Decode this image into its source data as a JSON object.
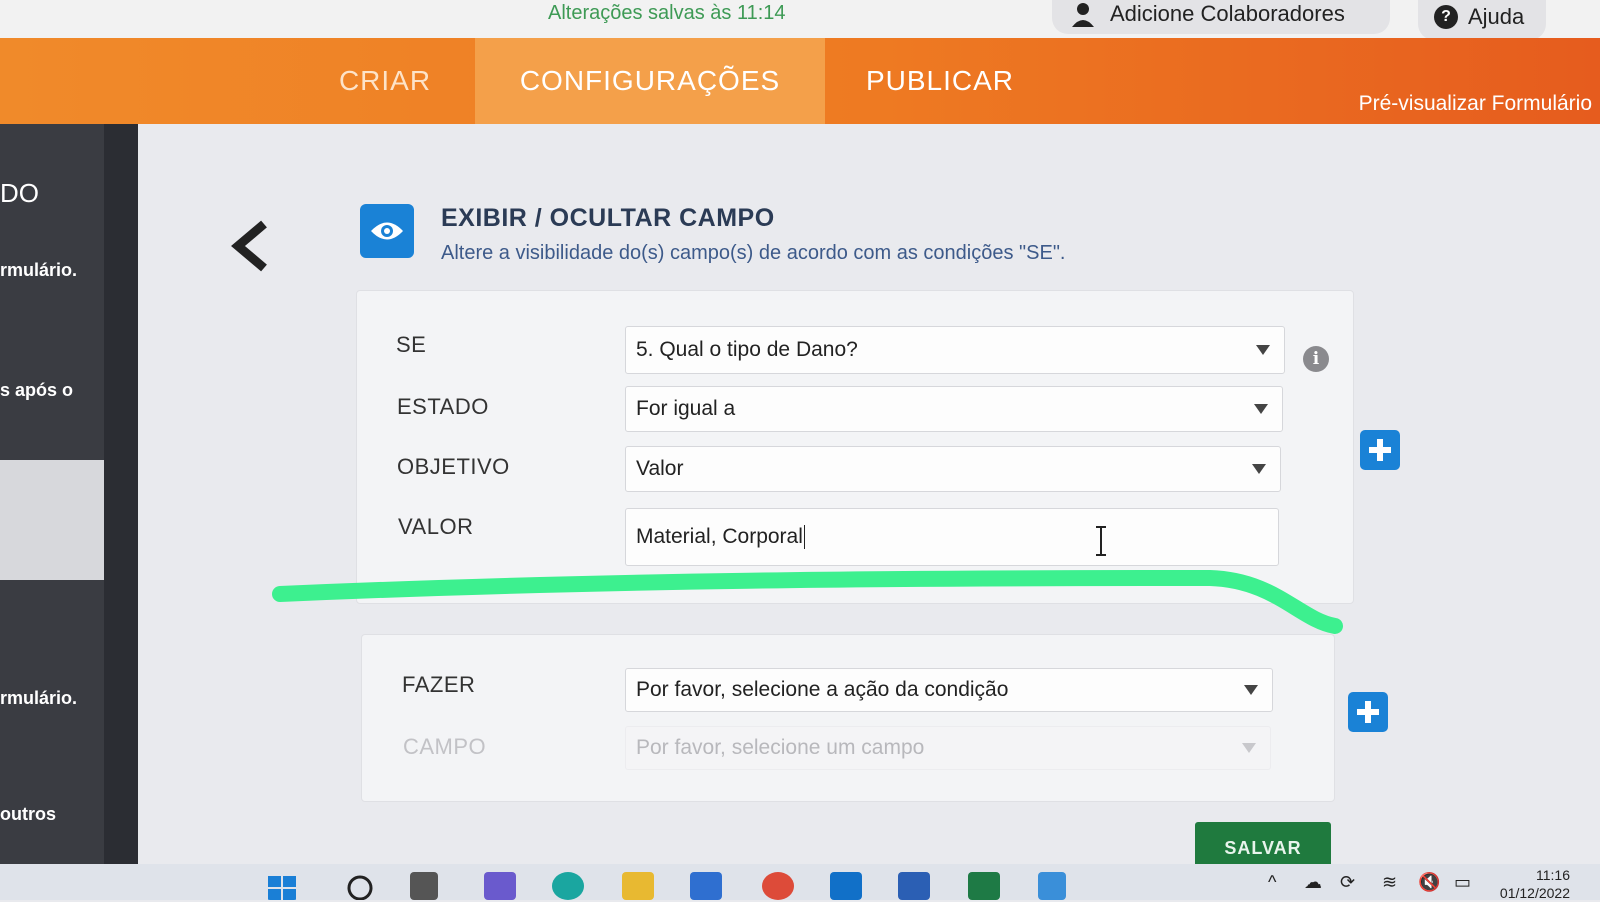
{
  "header": {
    "saved_status": "Alterações salvas às 11:14",
    "collaborators_label": "Adicione Colaboradores",
    "help_label": "Ajuda"
  },
  "nav": {
    "tabs": [
      {
        "label": "CRIAR"
      },
      {
        "label": "CONFIGURAÇÕES"
      },
      {
        "label": "PUBLICAR"
      }
    ],
    "active_tab": "CONFIGURAÇÕES",
    "preview_label": "Pré-visualizar Formulário"
  },
  "sidebar": {
    "fragments": [
      "DO",
      "rmulário.",
      "s após o",
      "rmulário.",
      "outros"
    ]
  },
  "panel": {
    "title": "EXIBIR / OCULTAR CAMPO",
    "subtitle": "Altere a visibilidade do(s) campo(s) de acordo com as condições \"SE\"."
  },
  "condition": {
    "se_label": "SE",
    "se_value": "5. Qual o tipo de Dano?",
    "estado_label": "ESTADO",
    "estado_value": "For igual a",
    "objetivo_label": "OBJETIVO",
    "objetivo_value": "Valor",
    "valor_label": "VALOR",
    "valor_value": "Material, Corporal"
  },
  "action": {
    "fazer_label": "FAZER",
    "fazer_placeholder": "Por favor, selecione a ação da condição",
    "campo_label": "CAMPO",
    "campo_placeholder": "Por favor, selecione um campo"
  },
  "save_label": "SALVAR",
  "taskbar": {
    "time": "11:16",
    "date": "01/12/2022"
  },
  "colors": {
    "accent_orange": "#ee7a22",
    "active_tab": "#f4a04a",
    "primary_blue": "#1a82d6",
    "save_green": "#1f7a3e",
    "highlight_green": "#3df08f"
  }
}
